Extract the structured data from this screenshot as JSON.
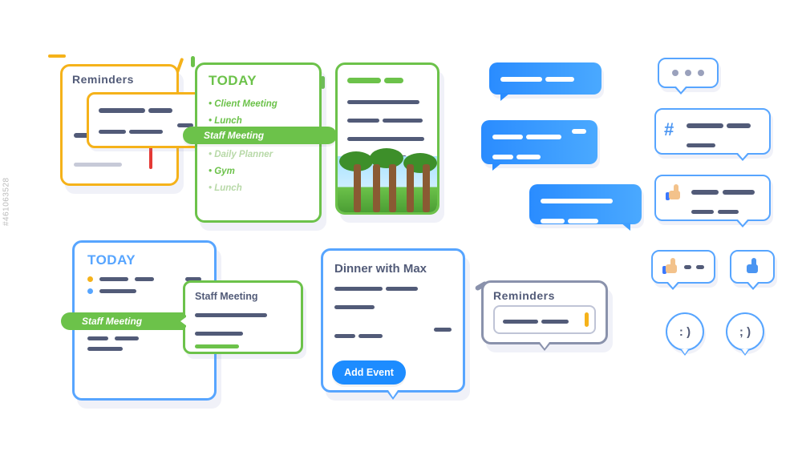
{
  "watermark": "#461063528",
  "reminders_yellow": {
    "title": "Reminders"
  },
  "today_green": {
    "title": "TODAY",
    "items": [
      {
        "label": "Client Meeting",
        "muted": false
      },
      {
        "label": "Lunch",
        "muted": false
      },
      {
        "label": "Staff Meeting",
        "muted": false
      },
      {
        "label": "Daily Planner",
        "muted": true
      },
      {
        "label": "Gym",
        "muted": false
      },
      {
        "label": "Lunch",
        "muted": true
      }
    ],
    "banner": "Staff Meeting"
  },
  "today_blue": {
    "title": "TODAY",
    "banner": "Staff Meeting",
    "popover_title": "Staff Meeting"
  },
  "dinner": {
    "title": "Dinner with Max",
    "button": "Add Event"
  },
  "reminders_grey": {
    "title": "Reminders"
  },
  "smileys": {
    "a": ": )",
    "b": "; )"
  },
  "hash": "#"
}
